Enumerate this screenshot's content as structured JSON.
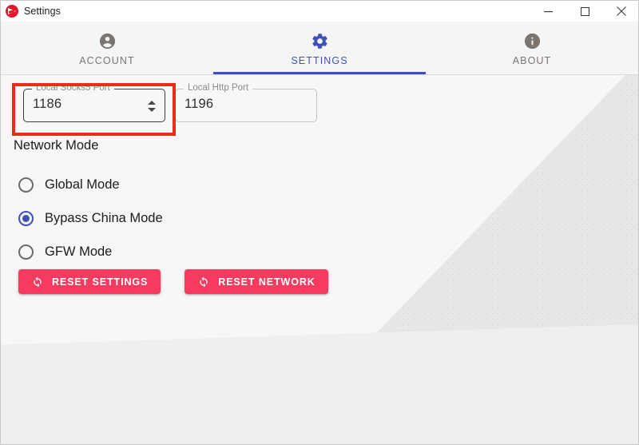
{
  "window": {
    "title": "Settings",
    "logo_icon": "paper-plane-logo",
    "controls": [
      {
        "name": "minimize",
        "icon": "minimize-icon"
      },
      {
        "name": "maximize",
        "icon": "maximize-icon"
      },
      {
        "name": "close",
        "icon": "close-icon"
      }
    ]
  },
  "tabs": [
    {
      "label": "ACCOUNT",
      "icon": "account-icon",
      "active": false
    },
    {
      "label": "SETTINGS",
      "icon": "gear-icon",
      "active": true
    },
    {
      "label": "ABOUT",
      "icon": "info-icon",
      "active": false
    }
  ],
  "fields": [
    {
      "legend": "Local Socks5 Port",
      "value": "1186",
      "focused": true,
      "has_spinner": true,
      "highlighted": true
    },
    {
      "legend": "Local Http Port",
      "value": "1196",
      "focused": false,
      "has_spinner": false,
      "highlighted": false
    }
  ],
  "network_mode": {
    "title": "Network Mode",
    "options": [
      {
        "label": "Global Mode",
        "checked": false
      },
      {
        "label": "Bypass China Mode",
        "checked": true
      },
      {
        "label": "GFW Mode",
        "checked": false
      }
    ]
  },
  "buttons": [
    {
      "label": "RESET SETTINGS",
      "icon": "refresh-icon"
    },
    {
      "label": "RESET NETWORK",
      "icon": "refresh-icon"
    }
  ],
  "colors": {
    "accent_blue": "#3f51b5",
    "button_pink": "#f73a5f",
    "highlight_red": "#ee2b18",
    "logo_red": "#e8142d"
  }
}
